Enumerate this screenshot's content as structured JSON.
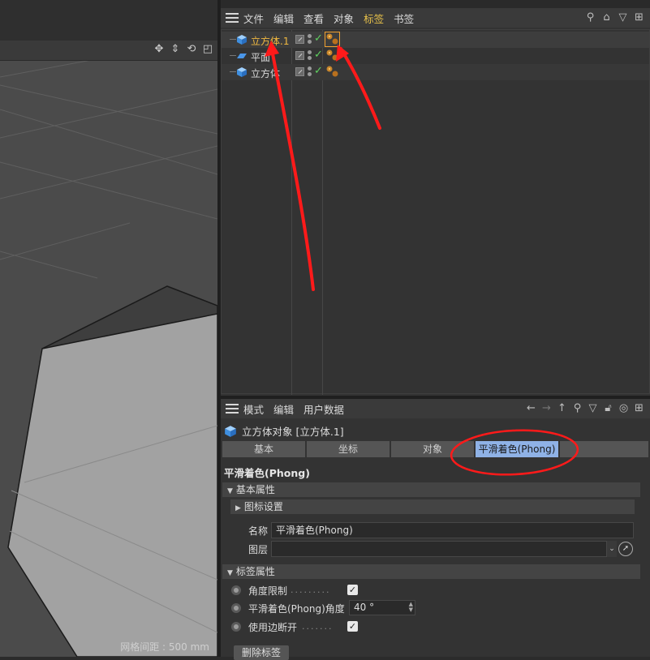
{
  "viewport": {
    "nav_icons": [
      "move-view-icon",
      "pan-view-icon",
      "rotate-view-icon",
      "maximize-view-icon"
    ],
    "grid_readout": "网格间距 : 500 mm"
  },
  "object_manager": {
    "menu": [
      "文件",
      "编辑",
      "查看",
      "对象",
      "标签",
      "书签"
    ],
    "active_menu": "标签",
    "toolbar_icons": [
      "search-icon",
      "home-icon",
      "filter-icon",
      "new-panel-icon"
    ],
    "objects": [
      {
        "name": "立方体.1",
        "icon": "cube-icon",
        "selected": true,
        "tag_selected": true
      },
      {
        "name": "平面",
        "icon": "plane-icon",
        "selected": false,
        "tag_selected": false
      },
      {
        "name": "立方体",
        "icon": "cube-icon",
        "selected": false,
        "tag_selected": false
      }
    ]
  },
  "attributes": {
    "menu": [
      "模式",
      "编辑",
      "用户数据"
    ],
    "toolbar_icons": [
      "back-arrow-icon",
      "forward-arrow-icon",
      "up-arrow-icon",
      "search-icon",
      "filter-icon",
      "lock-icon",
      "target-icon",
      "new-panel-icon"
    ],
    "object_title": "立方体对象 [立方体.1]",
    "tabs": [
      "基本",
      "坐标",
      "对象",
      "平滑着色(Phong)"
    ],
    "active_tab": "平滑着色(Phong)",
    "section_title": "平滑着色(Phong)",
    "basic_group": "基本属性",
    "icon_settings_group": "图标设置",
    "name_label": "名称",
    "name_value": "平滑着色(Phong)",
    "layer_label": "图层",
    "layer_value": "",
    "tag_group": "标签属性",
    "angle_limit_label": "角度限制",
    "angle_limit_checked": true,
    "phong_angle_label": "平滑着色(Phong)角度",
    "phong_angle_value": "40 °",
    "edge_breaks_label": "使用边断开",
    "edge_breaks_checked": true,
    "delete_button": "删除标签"
  },
  "colors": {
    "selected_text": "#f0b840",
    "active_tab": "#8fb2e6",
    "annotation": "#ff1a1a",
    "check_green": "#5fd15f"
  }
}
